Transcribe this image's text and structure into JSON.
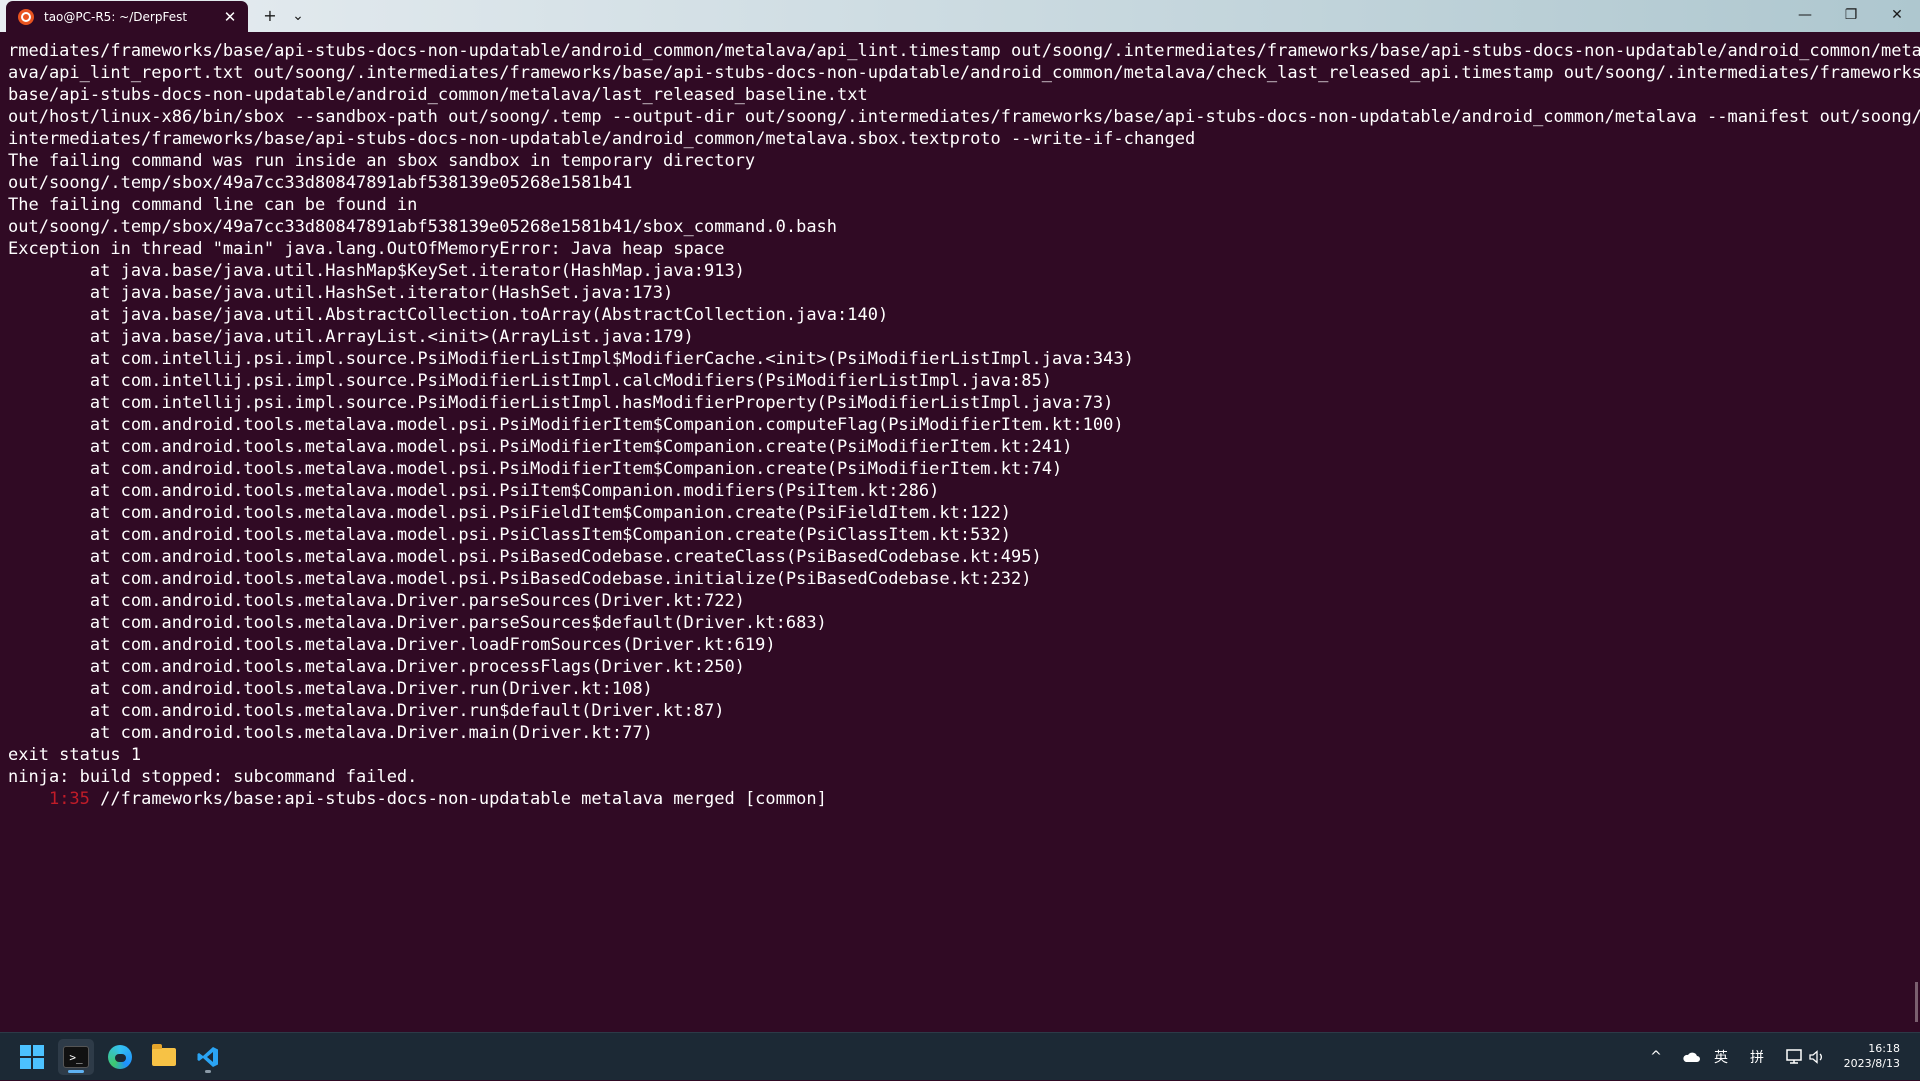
{
  "window": {
    "tab_title": "tao@PC-R5: ~/DerpFest",
    "tab_close": "✕",
    "new_tab": "+",
    "dropdown": "⌄",
    "minimize": "—",
    "restore": "❐",
    "close": "✕"
  },
  "terminal": {
    "lines": [
      "rmediates/frameworks/base/api-stubs-docs-non-updatable/android_common/metalava/api_lint.timestamp out/soong/.intermediates/frameworks/base/api-stubs-docs-non-updatable/android_common/metal",
      "ava/api_lint_report.txt out/soong/.intermediates/frameworks/base/api-stubs-docs-non-updatable/android_common/metalava/check_last_released_api.timestamp out/soong/.intermediates/frameworks/",
      "base/api-stubs-docs-non-updatable/android_common/metalava/last_released_baseline.txt",
      "out/host/linux-x86/bin/sbox --sandbox-path out/soong/.temp --output-dir out/soong/.intermediates/frameworks/base/api-stubs-docs-non-updatable/android_common/metalava --manifest out/soong/.",
      "intermediates/frameworks/base/api-stubs-docs-non-updatable/android_common/metalava.sbox.textproto --write-if-changed",
      "The failing command was run inside an sbox sandbox in temporary directory",
      "out/soong/.temp/sbox/49a7cc33d80847891abf538139e05268e1581b41",
      "The failing command line can be found in",
      "out/soong/.temp/sbox/49a7cc33d80847891abf538139e05268e1581b41/sbox_command.0.bash",
      "Exception in thread \"main\" java.lang.OutOfMemoryError: Java heap space",
      "        at java.base/java.util.HashMap$KeySet.iterator(HashMap.java:913)",
      "        at java.base/java.util.HashSet.iterator(HashSet.java:173)",
      "        at java.base/java.util.AbstractCollection.toArray(AbstractCollection.java:140)",
      "        at java.base/java.util.ArrayList.<init>(ArrayList.java:179)",
      "        at com.intellij.psi.impl.source.PsiModifierListImpl$ModifierCache.<init>(PsiModifierListImpl.java:343)",
      "        at com.intellij.psi.impl.source.PsiModifierListImpl.calcModifiers(PsiModifierListImpl.java:85)",
      "        at com.intellij.psi.impl.source.PsiModifierListImpl.hasModifierProperty(PsiModifierListImpl.java:73)",
      "        at com.android.tools.metalava.model.psi.PsiModifierItem$Companion.computeFlag(PsiModifierItem.kt:100)",
      "        at com.android.tools.metalava.model.psi.PsiModifierItem$Companion.create(PsiModifierItem.kt:241)",
      "        at com.android.tools.metalava.model.psi.PsiModifierItem$Companion.create(PsiModifierItem.kt:74)",
      "        at com.android.tools.metalava.model.psi.PsiItem$Companion.modifiers(PsiItem.kt:286)",
      "        at com.android.tools.metalava.model.psi.PsiFieldItem$Companion.create(PsiFieldItem.kt:122)",
      "        at com.android.tools.metalava.model.psi.PsiClassItem$Companion.create(PsiClassItem.kt:532)",
      "        at com.android.tools.metalava.model.psi.PsiBasedCodebase.createClass(PsiBasedCodebase.kt:495)",
      "        at com.android.tools.metalava.model.psi.PsiBasedCodebase.initialize(PsiBasedCodebase.kt:232)",
      "        at com.android.tools.metalava.Driver.parseSources(Driver.kt:722)",
      "        at com.android.tools.metalava.Driver.parseSources$default(Driver.kt:683)",
      "        at com.android.tools.metalava.Driver.loadFromSources(Driver.kt:619)",
      "        at com.android.tools.metalava.Driver.processFlags(Driver.kt:250)",
      "        at com.android.tools.metalava.Driver.run(Driver.kt:108)",
      "        at com.android.tools.metalava.Driver.run$default(Driver.kt:87)",
      "        at com.android.tools.metalava.Driver.main(Driver.kt:77)",
      "exit status 1",
      "ninja: build stopped: subcommand failed."
    ],
    "progress_indent": "    ",
    "progress_timer": "1:35",
    "progress_text": " //frameworks/base:api-stubs-docs-non-updatable metalava merged [common]",
    "timer_color": "#c01c28"
  },
  "taskbar": {
    "terminal_glyph": ">_",
    "tray_chevron": "^",
    "ime_lang": "英",
    "ime_mode": "拼",
    "time": "16:18",
    "date": "2023/8/13",
    "accent": "#4cc2ff"
  },
  "colors": {
    "terminal_bg": "#300a24",
    "terminal_fg": "#ffffff",
    "taskbar_bg": "#1c2935"
  }
}
